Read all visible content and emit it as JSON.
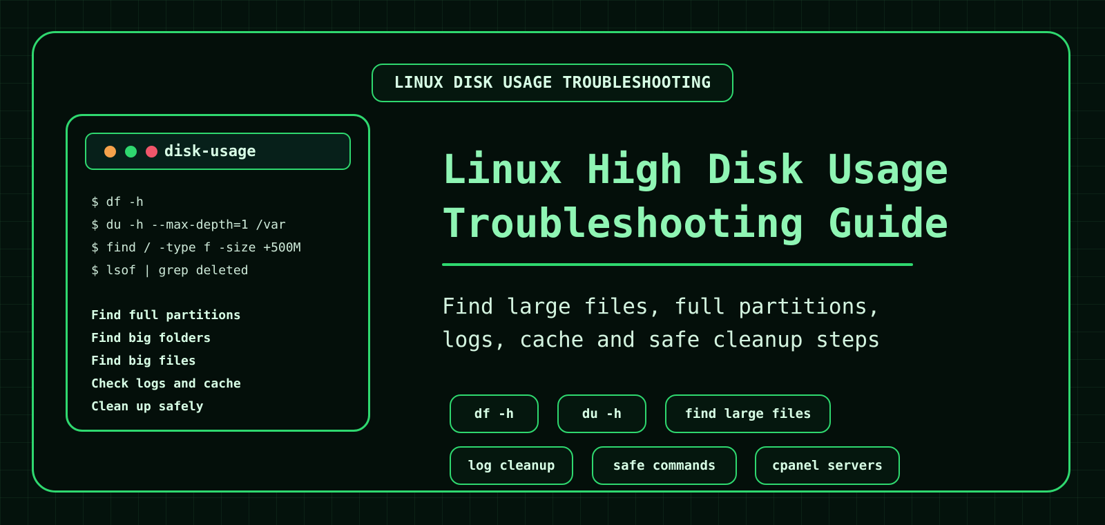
{
  "header": {
    "badge": "LINUX DISK USAGE TROUBLESHOOTING"
  },
  "terminal": {
    "title": "disk-usage",
    "dot_colors": [
      "#f5a24b",
      "#2fd86f",
      "#f0566a"
    ],
    "commands": [
      "$ df -h",
      "$ du -h --max-depth=1 /var",
      "$ find / -type f -size +500M",
      "$ lsof | grep deleted"
    ],
    "steps": [
      "Find full partitions",
      "Find big folders",
      "Find big files",
      "Check logs and cache",
      "Clean up safely"
    ]
  },
  "main": {
    "title_lines": [
      "Linux High Disk Usage",
      "Troubleshooting Guide"
    ],
    "subtitle_lines": [
      "Find large files, full partitions,",
      "logs, cache and safe cleanup steps"
    ],
    "tags": [
      "df -h",
      "du -h",
      "find large files",
      "log cleanup",
      "safe commands",
      "cpanel servers"
    ]
  },
  "colors": {
    "accent": "#2fd86f",
    "title": "#8ff5b4",
    "background": "#04120c"
  }
}
